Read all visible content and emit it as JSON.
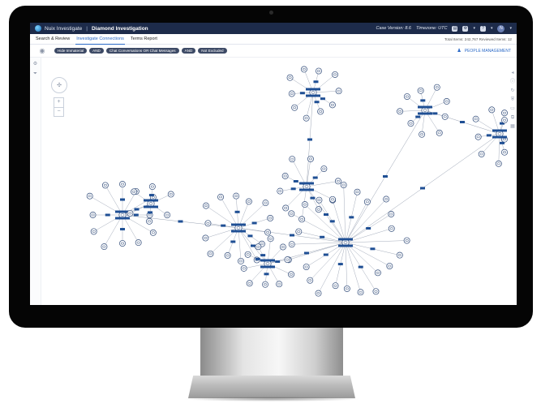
{
  "titlebar": {
    "app_name": "Nuix Investigate",
    "separator": "|",
    "case_name": "Diamond Investigation",
    "case_version": "Case Version: 8.6",
    "timezone": "Timezone: UTC",
    "avatar_initial": "N"
  },
  "tabs": [
    {
      "label": "Search & Review",
      "active": false
    },
    {
      "label": "Investigate Connections",
      "active": true
    },
    {
      "label": "Terms Report",
      "active": false
    }
  ],
  "stats": "Total Items: 242,767   Reviewed Items: 12",
  "filters": [
    "Hide Immaterial",
    "AND",
    "Chat Conversations OR Chat Messages",
    "AND",
    "Not Excluded"
  ],
  "people_management": "PEOPLE MANAGEMENT",
  "zoom": {
    "in": "+",
    "out": "−"
  },
  "colors": {
    "titlebar": "#1d2b4a",
    "accent": "#2a69c7",
    "chip": "#3d4a66",
    "node_stroke": "#2f4a78",
    "edge_label": "#1f4f94",
    "edge": "#9aa3b3"
  },
  "icons": {
    "eye": "eye-icon",
    "people": "person-icon",
    "compass": "navigation-compass-icon"
  }
}
